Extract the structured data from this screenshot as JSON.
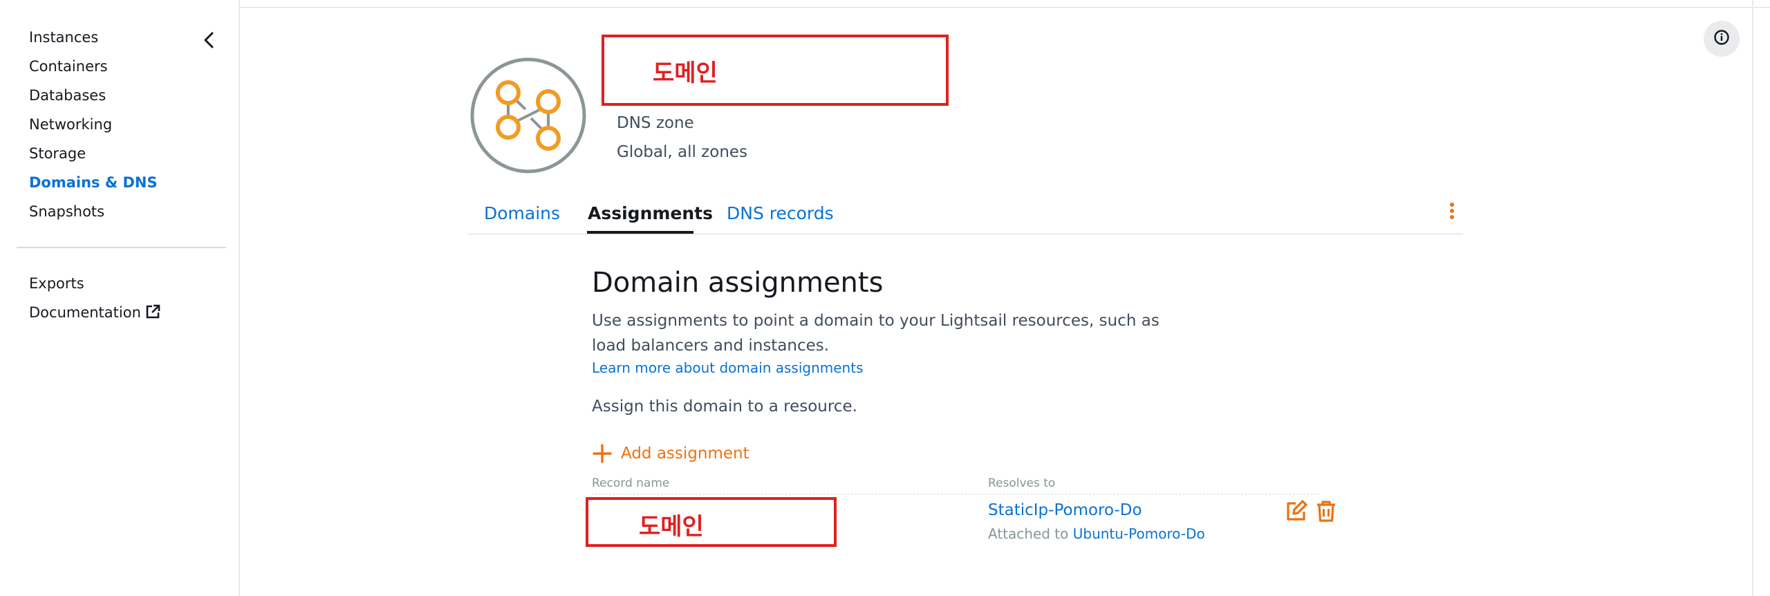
{
  "sidebar": {
    "items": [
      {
        "label": "Instances"
      },
      {
        "label": "Containers"
      },
      {
        "label": "Databases"
      },
      {
        "label": "Networking"
      },
      {
        "label": "Storage"
      },
      {
        "label": "Domains & DNS",
        "active": true
      },
      {
        "label": "Snapshots"
      }
    ],
    "secondary": [
      {
        "label": "Exports"
      },
      {
        "label": "Documentation"
      }
    ]
  },
  "header": {
    "title": "도메인",
    "type_label": "DNS zone",
    "location_label": "Global, all zones"
  },
  "tabs": [
    {
      "label": "Domains"
    },
    {
      "label": "Assignments",
      "active": true
    },
    {
      "label": "DNS records"
    }
  ],
  "assignments": {
    "heading": "Domain assignments",
    "description": "Use assignments to point a domain to your Lightsail resources, such as load balancers and instances.",
    "learn_more": "Learn more about domain assignments",
    "assign_prompt": "Assign this domain to a resource.",
    "add_button": "Add assignment",
    "columns": {
      "record_name": "Record name",
      "resolves_to": "Resolves to"
    },
    "rows": [
      {
        "record_name": "도메인",
        "resolves_to": "StaticIp-Pomoro-Do",
        "attached_prefix": "Attached to",
        "attached_to": "Ubuntu-Pomoro-Do"
      }
    ]
  },
  "icons": {
    "collapse": "chevron-left-icon",
    "external": "external-link-icon",
    "info": "info-icon",
    "more": "kebab-menu-icon",
    "add": "plus-icon",
    "edit": "edit-icon",
    "delete": "trash-icon",
    "logo": "dns-zone-icon"
  },
  "colors": {
    "link": "#0972d3",
    "accent_orange": "#ec7211",
    "redaction_red": "#e02020",
    "text_primary": "#16191f",
    "text_secondary": "#414d5c"
  }
}
